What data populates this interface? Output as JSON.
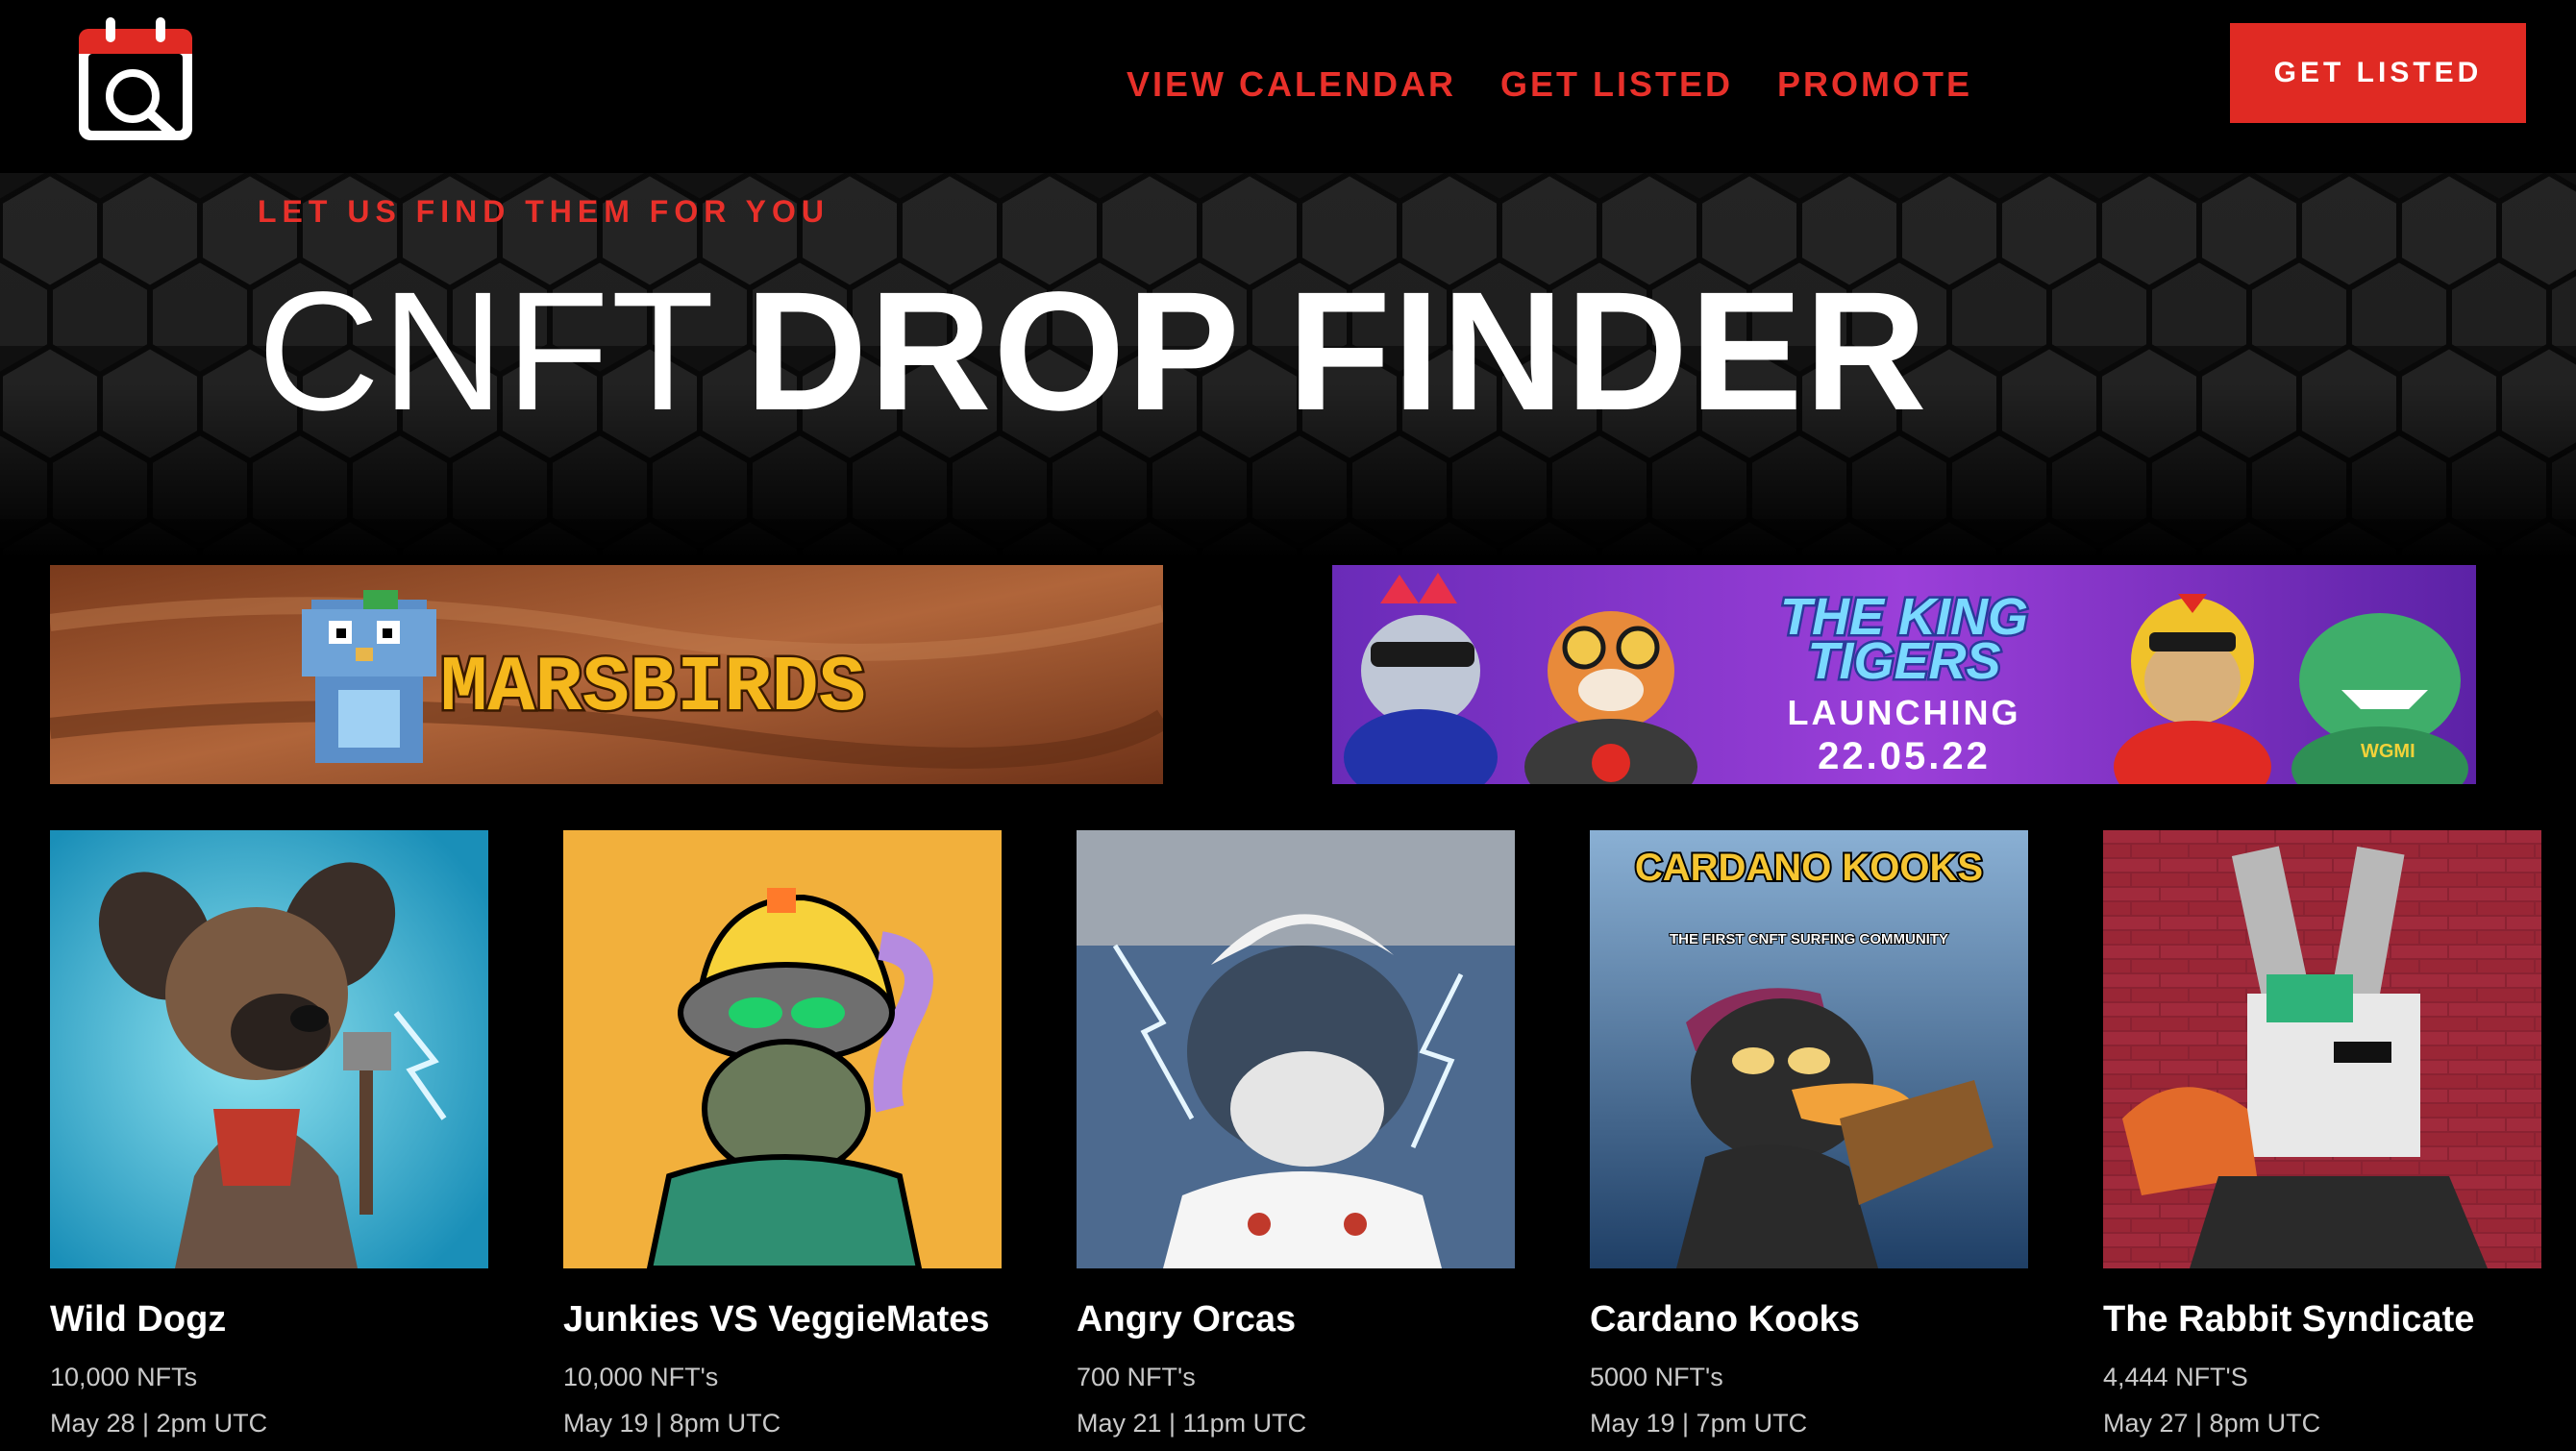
{
  "brand": {
    "logo_icon": "calendar-search-icon"
  },
  "nav": {
    "items": [
      {
        "label": "VIEW CALENDAR"
      },
      {
        "label": "GET LISTED"
      },
      {
        "label": "PROMOTE"
      }
    ],
    "cta_label": "GET LISTED"
  },
  "hero": {
    "kicker": "LET US FIND THEM FOR YOU",
    "title_light": "CNFT",
    "title_bold": "DROP FINDER"
  },
  "banners": {
    "marsbirds": {
      "text": "MARSBIRDS"
    },
    "kingtigers": {
      "title_line1": "THE KING",
      "title_line2": "TIGERS",
      "launch_label": "LAUNCHING",
      "launch_date": "22.05.22",
      "badge": "WGMI"
    }
  },
  "projects": [
    {
      "name": "Wild Dogz",
      "count": "10,000 NFTs",
      "date": "May 28 | 2pm UTC"
    },
    {
      "name": "Junkies VS VeggieMates",
      "count": "10,000 NFT's",
      "date": "May 19 | 8pm UTC"
    },
    {
      "name": "Angry Orcas",
      "count": "700 NFT's",
      "date": "May 21 | 11pm UTC"
    },
    {
      "name": "Cardano Kooks",
      "count": "5000 NFT's",
      "date": "May 19 | 7pm UTC",
      "art_title": "CARDANO KOOKS",
      "art_subtitle": "THE FIRST CNFT SURFING COMMUNITY"
    },
    {
      "name": "The Rabbit Syndicate",
      "count": "4,444 NFT'S",
      "date": "May 27 | 8pm UTC"
    }
  ],
  "colors": {
    "accent": "#e02a23",
    "nav_text": "#e8302a",
    "background": "#000000",
    "muted_text": "#c9c9c9"
  }
}
